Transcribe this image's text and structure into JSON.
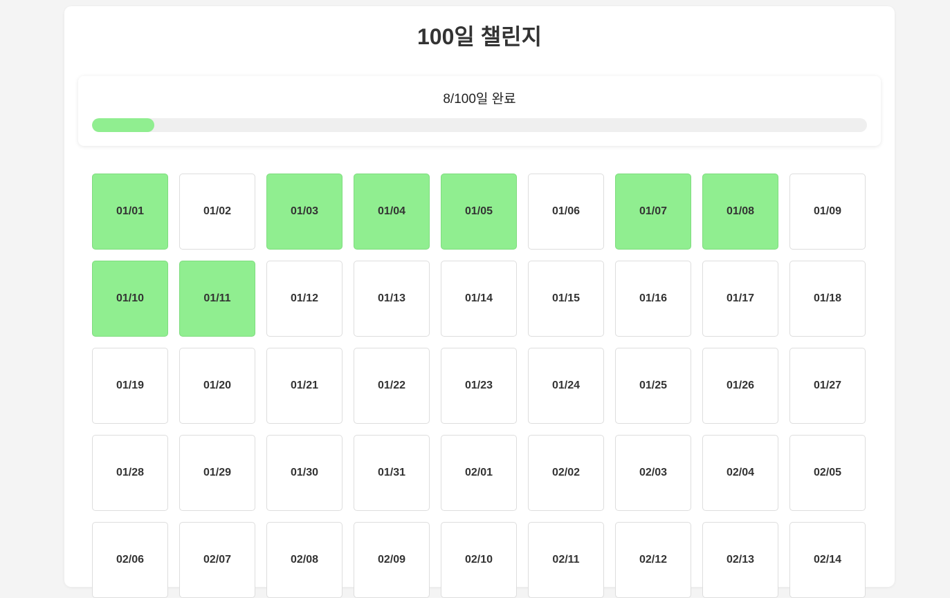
{
  "header": {
    "title": "100일 챌린지"
  },
  "progress": {
    "text": "8/100일 완료",
    "completed": 8,
    "total": 100,
    "fill_color": "#90ee90"
  },
  "days": [
    {
      "label": "01/01",
      "done": true
    },
    {
      "label": "01/02",
      "done": false
    },
    {
      "label": "01/03",
      "done": true
    },
    {
      "label": "01/04",
      "done": true
    },
    {
      "label": "01/05",
      "done": true
    },
    {
      "label": "01/06",
      "done": false
    },
    {
      "label": "01/07",
      "done": true
    },
    {
      "label": "01/08",
      "done": true
    },
    {
      "label": "01/09",
      "done": false
    },
    {
      "label": "01/10",
      "done": true
    },
    {
      "label": "01/11",
      "done": true
    },
    {
      "label": "01/12",
      "done": false
    },
    {
      "label": "01/13",
      "done": false
    },
    {
      "label": "01/14",
      "done": false
    },
    {
      "label": "01/15",
      "done": false
    },
    {
      "label": "01/16",
      "done": false
    },
    {
      "label": "01/17",
      "done": false
    },
    {
      "label": "01/18",
      "done": false
    },
    {
      "label": "01/19",
      "done": false
    },
    {
      "label": "01/20",
      "done": false
    },
    {
      "label": "01/21",
      "done": false
    },
    {
      "label": "01/22",
      "done": false
    },
    {
      "label": "01/23",
      "done": false
    },
    {
      "label": "01/24",
      "done": false
    },
    {
      "label": "01/25",
      "done": false
    },
    {
      "label": "01/26",
      "done": false
    },
    {
      "label": "01/27",
      "done": false
    },
    {
      "label": "01/28",
      "done": false
    },
    {
      "label": "01/29",
      "done": false
    },
    {
      "label": "01/30",
      "done": false
    },
    {
      "label": "01/31",
      "done": false
    },
    {
      "label": "02/01",
      "done": false
    },
    {
      "label": "02/02",
      "done": false
    },
    {
      "label": "02/03",
      "done": false
    },
    {
      "label": "02/04",
      "done": false
    },
    {
      "label": "02/05",
      "done": false
    },
    {
      "label": "02/06",
      "done": false
    },
    {
      "label": "02/07",
      "done": false
    },
    {
      "label": "02/08",
      "done": false
    },
    {
      "label": "02/09",
      "done": false
    },
    {
      "label": "02/10",
      "done": false
    },
    {
      "label": "02/11",
      "done": false
    },
    {
      "label": "02/12",
      "done": false
    },
    {
      "label": "02/13",
      "done": false
    },
    {
      "label": "02/14",
      "done": false
    }
  ]
}
